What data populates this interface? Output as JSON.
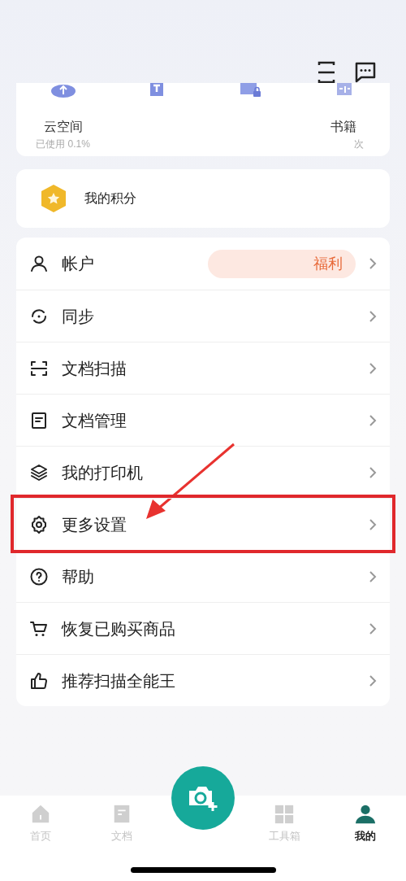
{
  "top_icons": [
    {
      "kind": "scan"
    },
    {
      "kind": "message"
    }
  ],
  "tiles": [
    {
      "kind": "cloud",
      "label": "云空间",
      "sub": "已使用 0.1%"
    },
    {
      "kind": "image"
    },
    {
      "kind": "word"
    },
    {
      "kind": "book",
      "label": "书籍",
      "sub": "次"
    }
  ],
  "points": {
    "label": "我的积分"
  },
  "menu": [
    {
      "kind": "user",
      "label": "帐户",
      "badge": "福利",
      "highlighted": false
    },
    {
      "kind": "sync",
      "label": "同步",
      "highlighted": false
    },
    {
      "kind": "scan",
      "label": "文档扫描",
      "highlighted": false
    },
    {
      "kind": "doc",
      "label": "文档管理",
      "highlighted": false
    },
    {
      "kind": "layers",
      "label": "我的打印机",
      "highlighted": false
    },
    {
      "kind": "gear",
      "label": "更多设置",
      "highlighted": true
    },
    {
      "kind": "help",
      "label": "帮助",
      "highlighted": false
    },
    {
      "kind": "cart",
      "label": "恢复已购买商品",
      "highlighted": false
    },
    {
      "kind": "thumb",
      "label": "推荐扫描全能王",
      "highlighted": false
    }
  ],
  "nav": [
    {
      "kind": "home",
      "label": "首页",
      "selected": false
    },
    {
      "kind": "doc",
      "label": "文档",
      "selected": false
    },
    {
      "kind": "camera"
    },
    {
      "kind": "tools",
      "label": "工具箱",
      "selected": false
    },
    {
      "kind": "me",
      "label": "我的",
      "selected": true
    }
  ]
}
